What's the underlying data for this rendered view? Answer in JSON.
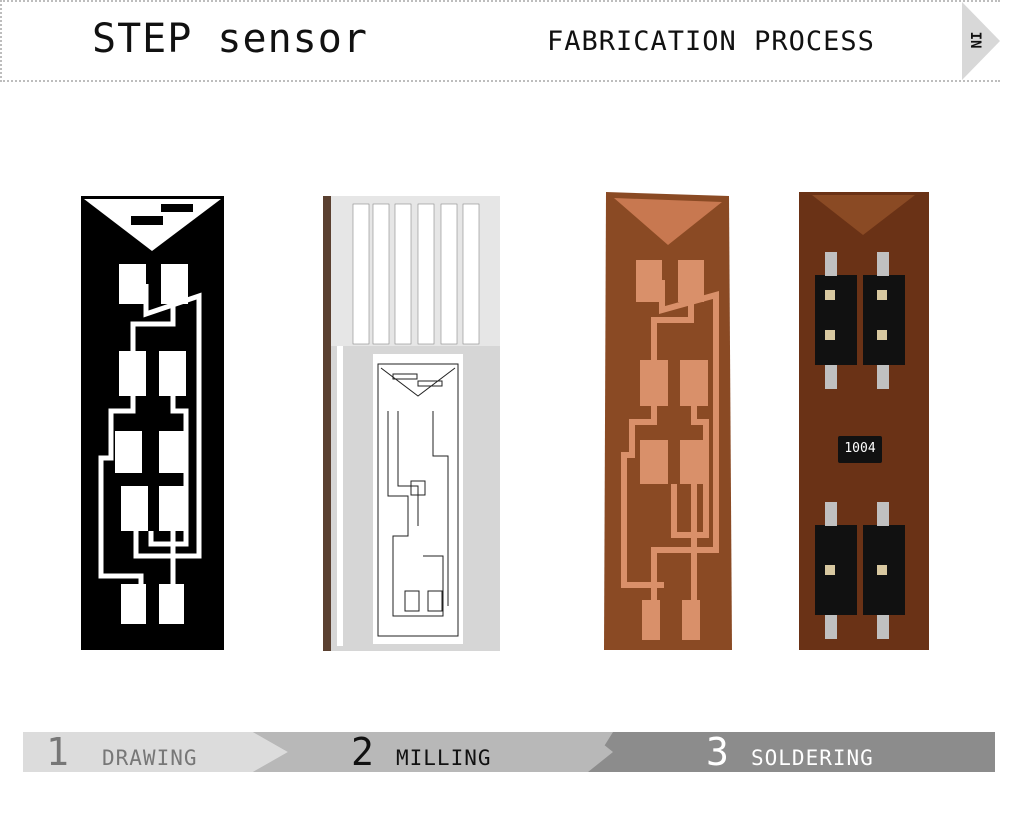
{
  "header": {
    "title": "STEP sensor",
    "subtitle": "FABRICATION PROCESS",
    "nav_label": "IN"
  },
  "panels": {
    "drawing": "pcb-drawing-black-white",
    "milling": "cad-py-toolpath-window",
    "milled": "milled-copper-board",
    "soldered": "soldered-board"
  },
  "soldered_board": {
    "resistor_code": "1004"
  },
  "steps": [
    {
      "number": "1",
      "label": "DRAWING"
    },
    {
      "number": "2",
      "label": "MILLING"
    },
    {
      "number": "3",
      "label": "SOLDERING"
    }
  ],
  "colors": {
    "step1_bg": "#dcdcdc",
    "step2_bg": "#b8b8b8",
    "step3_bg": "#8c8c8c",
    "copper": "#d9906a",
    "board": "#8a4a24"
  }
}
